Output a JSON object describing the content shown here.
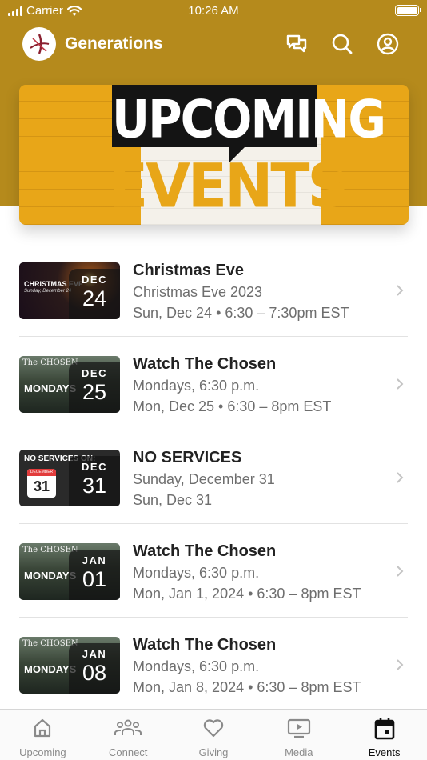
{
  "status_bar": {
    "carrier": "Carrier",
    "time": "10:26 AM"
  },
  "app_bar": {
    "title": "Generations"
  },
  "banner": {
    "line1": "UPCOMING",
    "line2": "EVENTS"
  },
  "events": [
    {
      "title": "Christmas Eve",
      "subtitle": "Christmas Eve 2023",
      "when": "Sun, Dec 24 • 6:30 – 7:30pm EST",
      "month": "DEC",
      "day": "24",
      "thumb_text": "CHRISTMAS EVE",
      "thumb_sub": "Sunday, December 24"
    },
    {
      "title": "Watch The Chosen",
      "subtitle": "Mondays, 6:30 p.m.",
      "when": "Mon, Dec 25 • 6:30 – 8pm EST",
      "month": "DEC",
      "day": "25",
      "thumb_brand": "The CHOSEN",
      "thumb_text": "MONDAYS"
    },
    {
      "title": "NO SERVICES",
      "subtitle": "Sunday, December 31",
      "when": "Sun, Dec 31",
      "month": "DEC",
      "day": "31",
      "thumb_text": "NO SERVICES ON:",
      "thumb_cal": "31",
      "thumb_cal_month": "DECEMBER"
    },
    {
      "title": "Watch The Chosen",
      "subtitle": "Mondays, 6:30 p.m.",
      "when": "Mon, Jan 1, 2024 • 6:30 – 8pm EST",
      "month": "JAN",
      "day": "01",
      "thumb_brand": "The CHOSEN",
      "thumb_text": "MONDAYS"
    },
    {
      "title": "Watch The Chosen",
      "subtitle": "Mondays, 6:30 p.m.",
      "when": "Mon, Jan 8, 2024 • 6:30 – 8pm EST",
      "month": "JAN",
      "day": "08",
      "thumb_brand": "The CHOSEN",
      "thumb_text": "MONDAYS"
    }
  ],
  "tab_bar": {
    "tabs": [
      {
        "label": "Upcoming",
        "icon": "home-icon"
      },
      {
        "label": "Connect",
        "icon": "people-icon"
      },
      {
        "label": "Giving",
        "icon": "heart-icon"
      },
      {
        "label": "Media",
        "icon": "media-play-icon"
      },
      {
        "label": "Events",
        "icon": "calendar-icon"
      }
    ],
    "active": "Events"
  },
  "colors": {
    "header": "#b58a1c",
    "banner_yellow": "#e8a618",
    "active_tab": "#111111",
    "inactive_tab": "#8a8a8a"
  }
}
